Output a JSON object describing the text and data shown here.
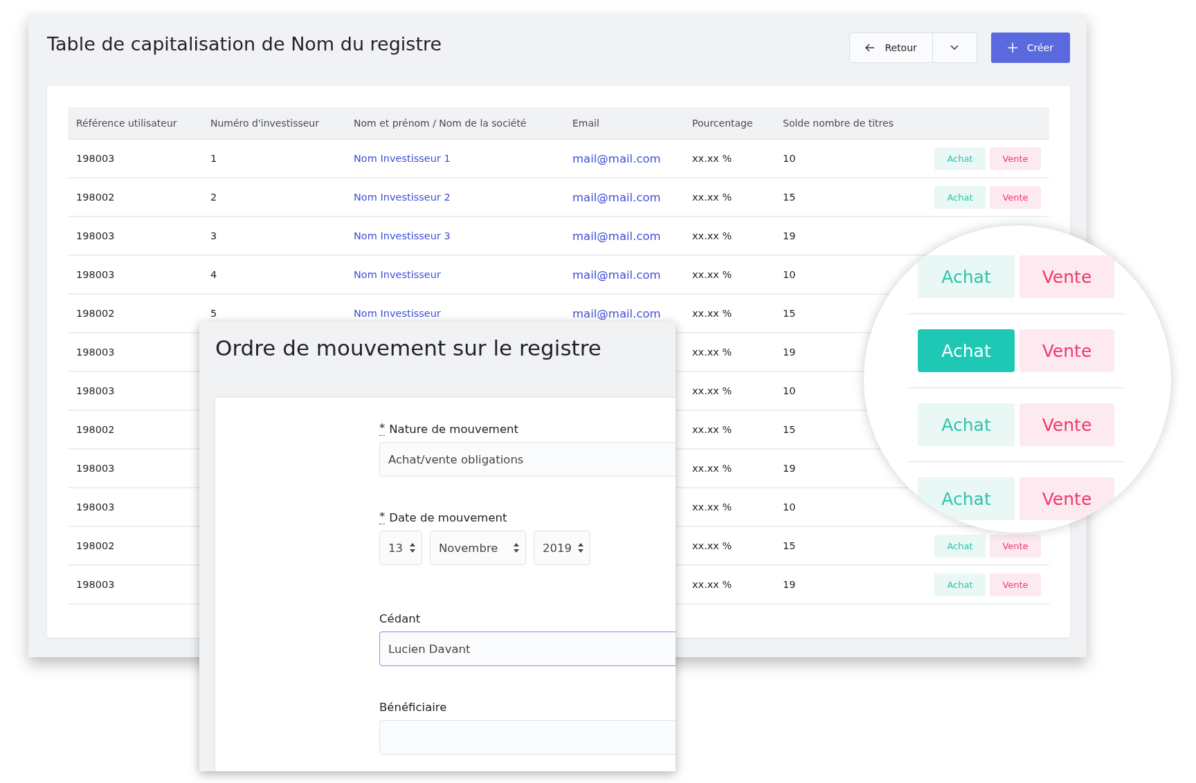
{
  "page": {
    "title": "Table de capitalisation de Nom du registre",
    "back_button": "Retour",
    "create_button": "Créer"
  },
  "table": {
    "columns": [
      "Référence utilisateur",
      "Numéro d'investisseur",
      "Nom et prénom / Nom de la société",
      "Email",
      "Pourcentage",
      "Solde nombre de titres"
    ],
    "rows": [
      {
        "reference": "198003",
        "numero": "1",
        "nom": "Nom Investisseur 1",
        "email": "mail@mail.com",
        "pourcentage": "xx.xx %",
        "solde": "10",
        "actions": {
          "achat": "Achat",
          "vente": "Vente"
        }
      },
      {
        "reference": "198002",
        "numero": "2",
        "nom": "Nom Investisseur 2",
        "email": "mail@mail.com",
        "pourcentage": "xx.xx %",
        "solde": "15",
        "actions": {
          "achat": "Achat",
          "vente": "Vente"
        }
      },
      {
        "reference": "198003",
        "numero": "3",
        "nom": "Nom Investisseur 3",
        "email": "mail@mail.com",
        "pourcentage": "xx.xx %",
        "solde": "19"
      },
      {
        "reference": "198003",
        "numero": "4",
        "nom": "Nom Investisseur",
        "email": "mail@mail.com",
        "pourcentage": "xx.xx %",
        "solde": "10"
      },
      {
        "reference": "198002",
        "numero": "5",
        "nom": "Nom Investisseur",
        "email": "mail@mail.com",
        "pourcentage": "xx.xx %",
        "solde": "15"
      },
      {
        "reference": "198003",
        "pourcentage": "xx.xx %",
        "solde": "19"
      },
      {
        "reference": "198003",
        "pourcentage": "xx.xx %",
        "solde": "10"
      },
      {
        "reference": "198002",
        "pourcentage": "xx.xx %",
        "solde": "15"
      },
      {
        "reference": "198003",
        "pourcentage": "xx.xx %",
        "solde": "19"
      },
      {
        "reference": "198003",
        "pourcentage": "xx.xx %",
        "solde": "10"
      },
      {
        "reference": "198002",
        "pourcentage": "xx.xx %",
        "solde": "15",
        "actions": {
          "achat": "Achat",
          "vente": "Vente"
        }
      },
      {
        "reference": "198003",
        "pourcentage": "xx.xx %",
        "solde": "19",
        "actions": {
          "achat": "Achat",
          "vente": "Vente"
        }
      }
    ]
  },
  "modal": {
    "title": "Ordre de mouvement sur le registre",
    "fields": [
      {
        "kind": "text",
        "required_mark": "*",
        "label": "Nature de mouvement",
        "value": "Achat/vente obligations",
        "focused": false
      },
      {
        "kind": "date",
        "required_mark": "*",
        "label": "Date de mouvement",
        "day": "13",
        "month": "Novembre",
        "year": "2019"
      },
      {
        "kind": "text",
        "label": "Cédant",
        "value": "Lucien Davant",
        "focused": true
      },
      {
        "kind": "text",
        "label": "Bénéficiaire",
        "focused": false
      }
    ]
  },
  "magnifier": [
    {
      "achat": "Achat",
      "vente": "Vente",
      "achat_selected": false
    },
    {
      "achat": "Achat",
      "vente": "Vente",
      "achat_selected": true
    },
    {
      "achat": "Achat",
      "vente": "Vente",
      "achat_selected": false
    },
    {
      "achat": "Achat",
      "vente": "Vente",
      "achat_selected": false
    }
  ]
}
